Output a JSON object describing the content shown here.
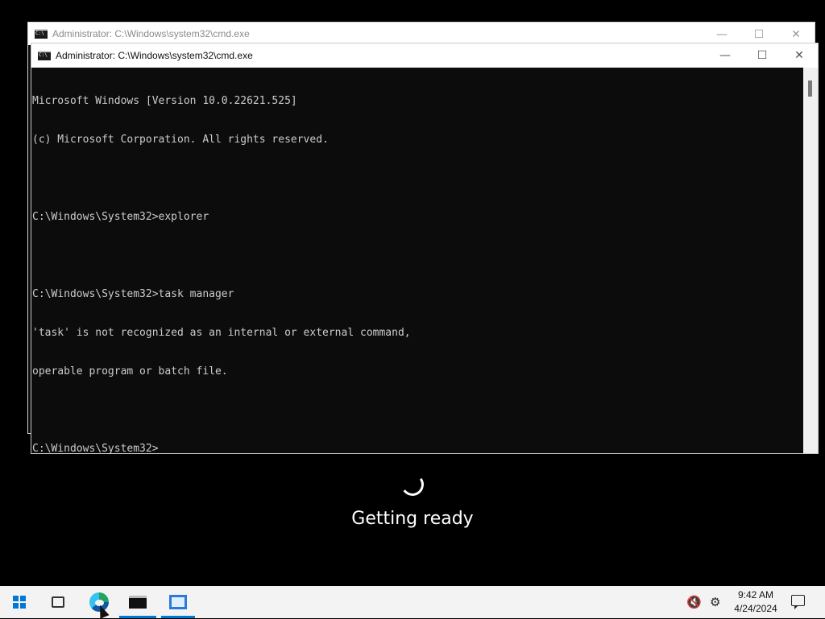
{
  "back_window": {
    "title": "Administrator: C:\\Windows\\system32\\cmd.exe"
  },
  "front_window": {
    "title": "Administrator: C:\\Windows\\system32\\cmd.exe",
    "console_lines": [
      "Microsoft Windows [Version 10.0.22621.525]",
      "(c) Microsoft Corporation. All rights reserved.",
      "",
      "C:\\Windows\\System32>explorer",
      "",
      "C:\\Windows\\System32>task manager",
      "'task' is not recognized as an internal or external command,",
      "operable program or batch file.",
      "",
      "C:\\Windows\\System32>"
    ]
  },
  "window_controls": {
    "minimize": "—",
    "maximize": "☐",
    "close": "✕"
  },
  "status": {
    "text": "Getting ready"
  },
  "taskbar": {
    "start_icon": "windows-logo-icon",
    "task_view_icon": "task-view-icon",
    "apps": [
      "edge-icon",
      "command-prompt-icon",
      "app-window-icon"
    ],
    "clock_time": "9:42 AM",
    "clock_date": "4/24/2024",
    "tray_icons": [
      "volume-muted-icon",
      "settings-gear-icon",
      "notification-icon"
    ],
    "accent": "#0078d4"
  }
}
